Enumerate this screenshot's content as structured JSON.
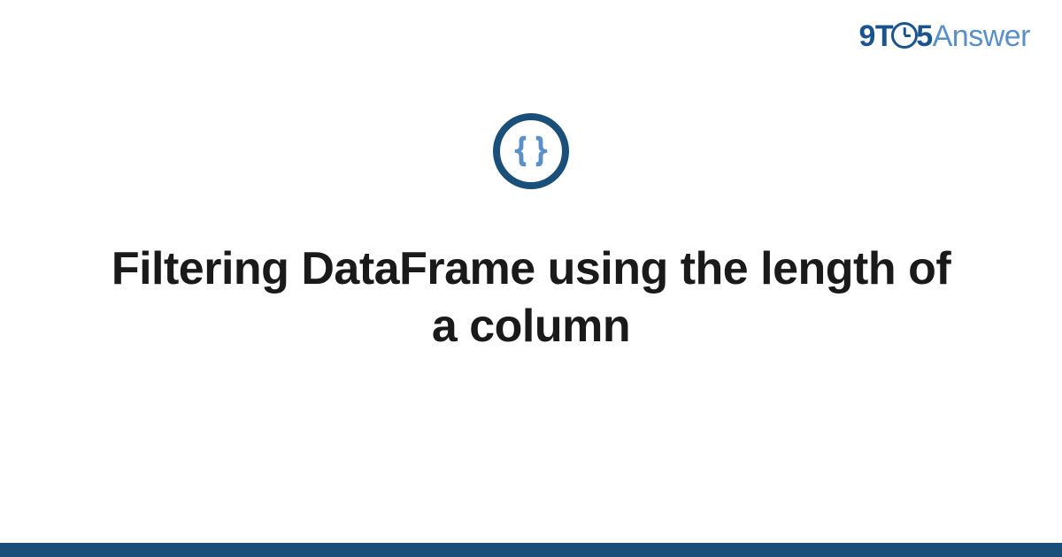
{
  "logo": {
    "part1": "9T",
    "part2": "5",
    "part3": "Answer"
  },
  "title": "Filtering DataFrame using the length of a column",
  "icon_name": "code-braces-icon",
  "colors": {
    "brand_dark": "#1a4f7a",
    "brand_light": "#5a8fc7",
    "text": "#1a1a1a"
  }
}
